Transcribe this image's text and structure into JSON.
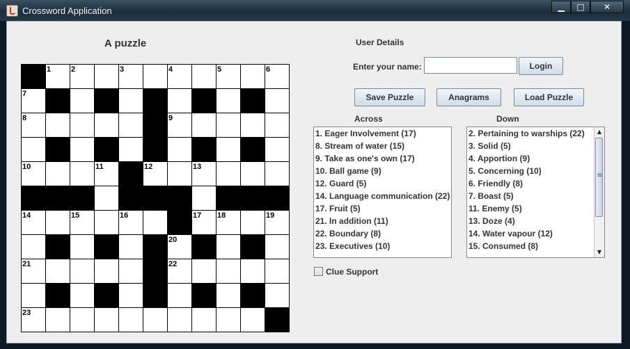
{
  "window": {
    "title": "Crossword Application",
    "minimize_label": "▁",
    "maximize_label": "□",
    "close_label": "✕"
  },
  "puzzle": {
    "title": "A puzzle",
    "grid": [
      [
        "#",
        "1",
        "2",
        "",
        "3",
        "",
        "4",
        "",
        "5",
        "",
        "6"
      ],
      [
        "7",
        "#",
        "",
        "#",
        "",
        "#",
        "",
        "#",
        "",
        "#",
        ""
      ],
      [
        "8",
        "",
        "",
        "",
        "",
        "#",
        "9",
        "",
        "",
        "",
        ""
      ],
      [
        "",
        "#",
        "",
        "#",
        "",
        "#",
        "",
        "#",
        "",
        "#",
        ""
      ],
      [
        "10",
        "",
        "",
        "11",
        "#",
        "12",
        "",
        "13",
        "",
        "",
        ""
      ],
      [
        "#",
        "#",
        "#",
        "",
        "#",
        "#",
        "#",
        "",
        "#",
        "#",
        "#"
      ],
      [
        "14",
        "",
        "15",
        "",
        "16",
        "",
        "#",
        "17",
        "18",
        "",
        "19"
      ],
      [
        "",
        "#",
        "",
        "#",
        "",
        "#",
        "20",
        "#",
        "",
        "#",
        ""
      ],
      [
        "21",
        "",
        "",
        "",
        "",
        "#",
        "22",
        "",
        "",
        "",
        ""
      ],
      [
        "",
        "#",
        "",
        "#",
        "",
        "#",
        "",
        "#",
        "",
        "#",
        ""
      ],
      [
        "23",
        "",
        "",
        "",
        "",
        "",
        "",
        "",
        "",
        "",
        "#"
      ]
    ]
  },
  "user": {
    "section_title": "User Details",
    "name_label": "Enter your name:",
    "name_value": "",
    "login_label": "Login"
  },
  "actions": {
    "save_label": "Save Puzzle",
    "anagrams_label": "Anagrams",
    "load_label": "Load Puzzle"
  },
  "across": {
    "heading": "Across",
    "items": [
      "1. Eager Involvement (17)",
      "8. Stream of water (15)",
      "9. Take as one's own (17)",
      "10. Ball game (9)",
      "12. Guard (5)",
      "14. Language communication (22)",
      "17. Fruit (5)",
      "21. In addition (11)",
      "22. Boundary (8)",
      "23. Executives (10)"
    ]
  },
  "down": {
    "heading": "Down",
    "items": [
      "2. Pertaining to warships (22)",
      "3. Solid (5)",
      "4. Apportion (9)",
      "5. Concerning (10)",
      "6. Friendly (8)",
      "7. Boast (5)",
      "11. Enemy (5)",
      "13. Doze (4)",
      "14. Water vapour (12)",
      "15. Consumed (8)"
    ]
  },
  "clue_support": {
    "label": "Clue Support",
    "checked": false
  }
}
